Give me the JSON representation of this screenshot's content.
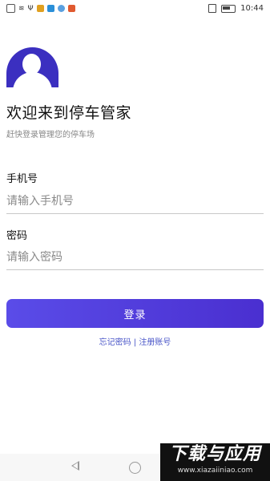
{
  "status_bar": {
    "time": "10:44"
  },
  "header": {
    "title": "欢迎来到停车管家",
    "subtitle": "赶快登录管理您的停车场"
  },
  "form": {
    "phone_label": "手机号",
    "phone_placeholder": "请输入手机号",
    "password_label": "密码",
    "password_placeholder": "请输入密码",
    "login_label": "登录"
  },
  "links": {
    "forgot_password": "忘记密码",
    "separator": "|",
    "register": "注册账号"
  },
  "watermark": {
    "main": "下载与应用",
    "sub": "www.xiazaiiniao.com"
  },
  "colors": {
    "accent": "#4a2fd0",
    "link": "#4a56c8"
  }
}
